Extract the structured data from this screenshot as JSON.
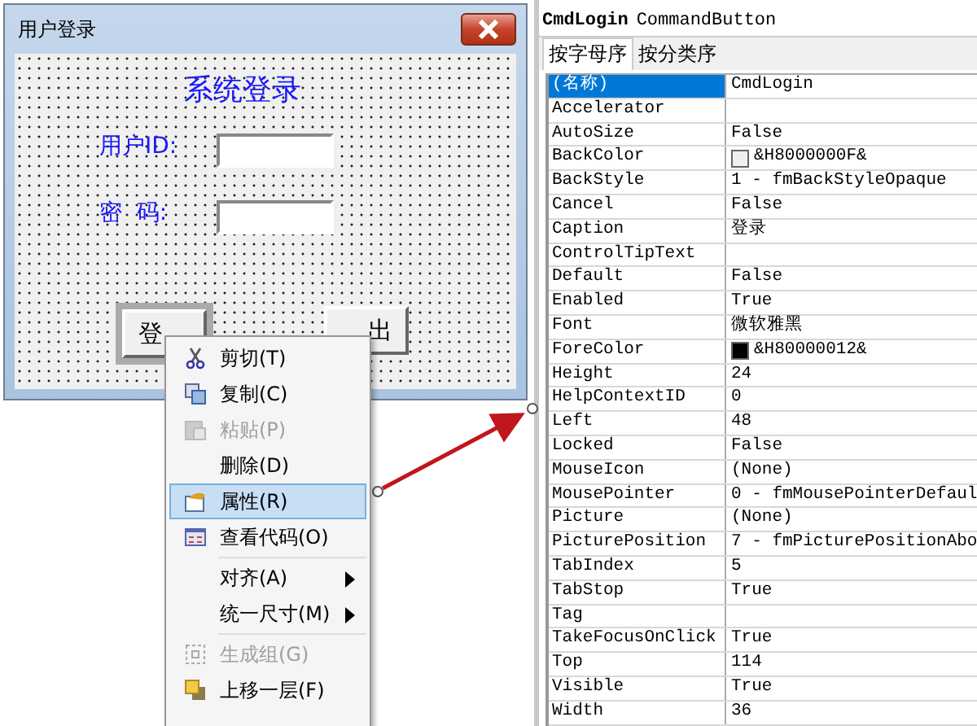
{
  "form_window": {
    "title": "用户登录",
    "heading": "系统登录",
    "fields": [
      {
        "label": "用户ID:"
      },
      {
        "label": "密  码:"
      }
    ],
    "buttons": [
      {
        "label": "登",
        "selected": true
      },
      {
        "label": "出",
        "selected": false
      }
    ]
  },
  "context_menu": [
    {
      "kind": "item",
      "label": "剪切(T)",
      "disabled": false,
      "selected": false,
      "submenu": false
    },
    {
      "kind": "item",
      "label": "复制(C)",
      "disabled": false,
      "selected": false,
      "submenu": false
    },
    {
      "kind": "item",
      "label": "粘贴(P)",
      "disabled": true,
      "selected": false,
      "submenu": false
    },
    {
      "kind": "item",
      "label": "删除(D)",
      "disabled": false,
      "selected": false,
      "submenu": false
    },
    {
      "kind": "item",
      "label": "属性(R)",
      "disabled": false,
      "selected": true,
      "submenu": false
    },
    {
      "kind": "item",
      "label": "查看代码(O)",
      "disabled": false,
      "selected": false,
      "submenu": false
    },
    {
      "kind": "separator"
    },
    {
      "kind": "item",
      "label": "对齐(A)",
      "disabled": false,
      "selected": false,
      "submenu": true
    },
    {
      "kind": "item",
      "label": "统一尺寸(M)",
      "disabled": false,
      "selected": false,
      "submenu": true
    },
    {
      "kind": "separator"
    },
    {
      "kind": "item",
      "label": "生成组(G)",
      "disabled": true,
      "selected": false,
      "submenu": false
    },
    {
      "kind": "item",
      "label": "上移一层(F)",
      "disabled": false,
      "selected": false,
      "submenu": false
    }
  ],
  "properties_panel": {
    "object_name": "CmdLogin",
    "object_type": "CommandButton",
    "tabs": [
      {
        "label": "按字母序",
        "selected": true
      },
      {
        "label": "按分类序",
        "selected": false
      }
    ],
    "rows": [
      {
        "name": "(名称)",
        "value": "CmdLogin",
        "selected": true
      },
      {
        "name": "Accelerator",
        "selected": false
      },
      {
        "name": "AutoSize",
        "value": "False",
        "selected": false
      },
      {
        "name": "BackColor",
        "value": "&H8000000F&",
        "color": "#f0f0f0",
        "selected": false
      },
      {
        "name": "BackStyle",
        "value": "1 - fmBackStyleOpaque",
        "selected": false
      },
      {
        "name": "Cancel",
        "value": "False",
        "selected": false
      },
      {
        "name": "Caption",
        "value": "登录",
        "selected": false
      },
      {
        "name": "ControlTipText",
        "selected": false
      },
      {
        "name": "Default",
        "value": "False",
        "selected": false
      },
      {
        "name": "Enabled",
        "value": "True",
        "selected": false
      },
      {
        "name": "Font",
        "value": "微软雅黑",
        "selected": false
      },
      {
        "name": "ForeColor",
        "value": "&H80000012&",
        "color": "#000000",
        "selected": false
      },
      {
        "name": "Height",
        "value": "24",
        "selected": false
      },
      {
        "name": "HelpContextID",
        "value": "0",
        "selected": false
      },
      {
        "name": "Left",
        "value": "48",
        "selected": false
      },
      {
        "name": "Locked",
        "value": "False",
        "selected": false
      },
      {
        "name": "MouseIcon",
        "value": "(None)",
        "selected": false
      },
      {
        "name": "MousePointer",
        "value": "0 - fmMousePointerDefaul",
        "selected": false
      },
      {
        "name": "Picture",
        "value": "(None)",
        "selected": false
      },
      {
        "name": "PicturePosition",
        "value": "7 - fmPicturePositionAbo",
        "selected": false
      },
      {
        "name": "TabIndex",
        "value": "5",
        "selected": false
      },
      {
        "name": "TabStop",
        "value": "True",
        "selected": false
      },
      {
        "name": "Tag",
        "selected": false
      },
      {
        "name": "TakeFocusOnClick",
        "value": "True",
        "selected": false
      },
      {
        "name": "Top",
        "value": "114",
        "selected": false
      },
      {
        "name": "Visible",
        "value": "True",
        "selected": false
      },
      {
        "name": "Width",
        "value": "36",
        "selected": false
      }
    ]
  }
}
